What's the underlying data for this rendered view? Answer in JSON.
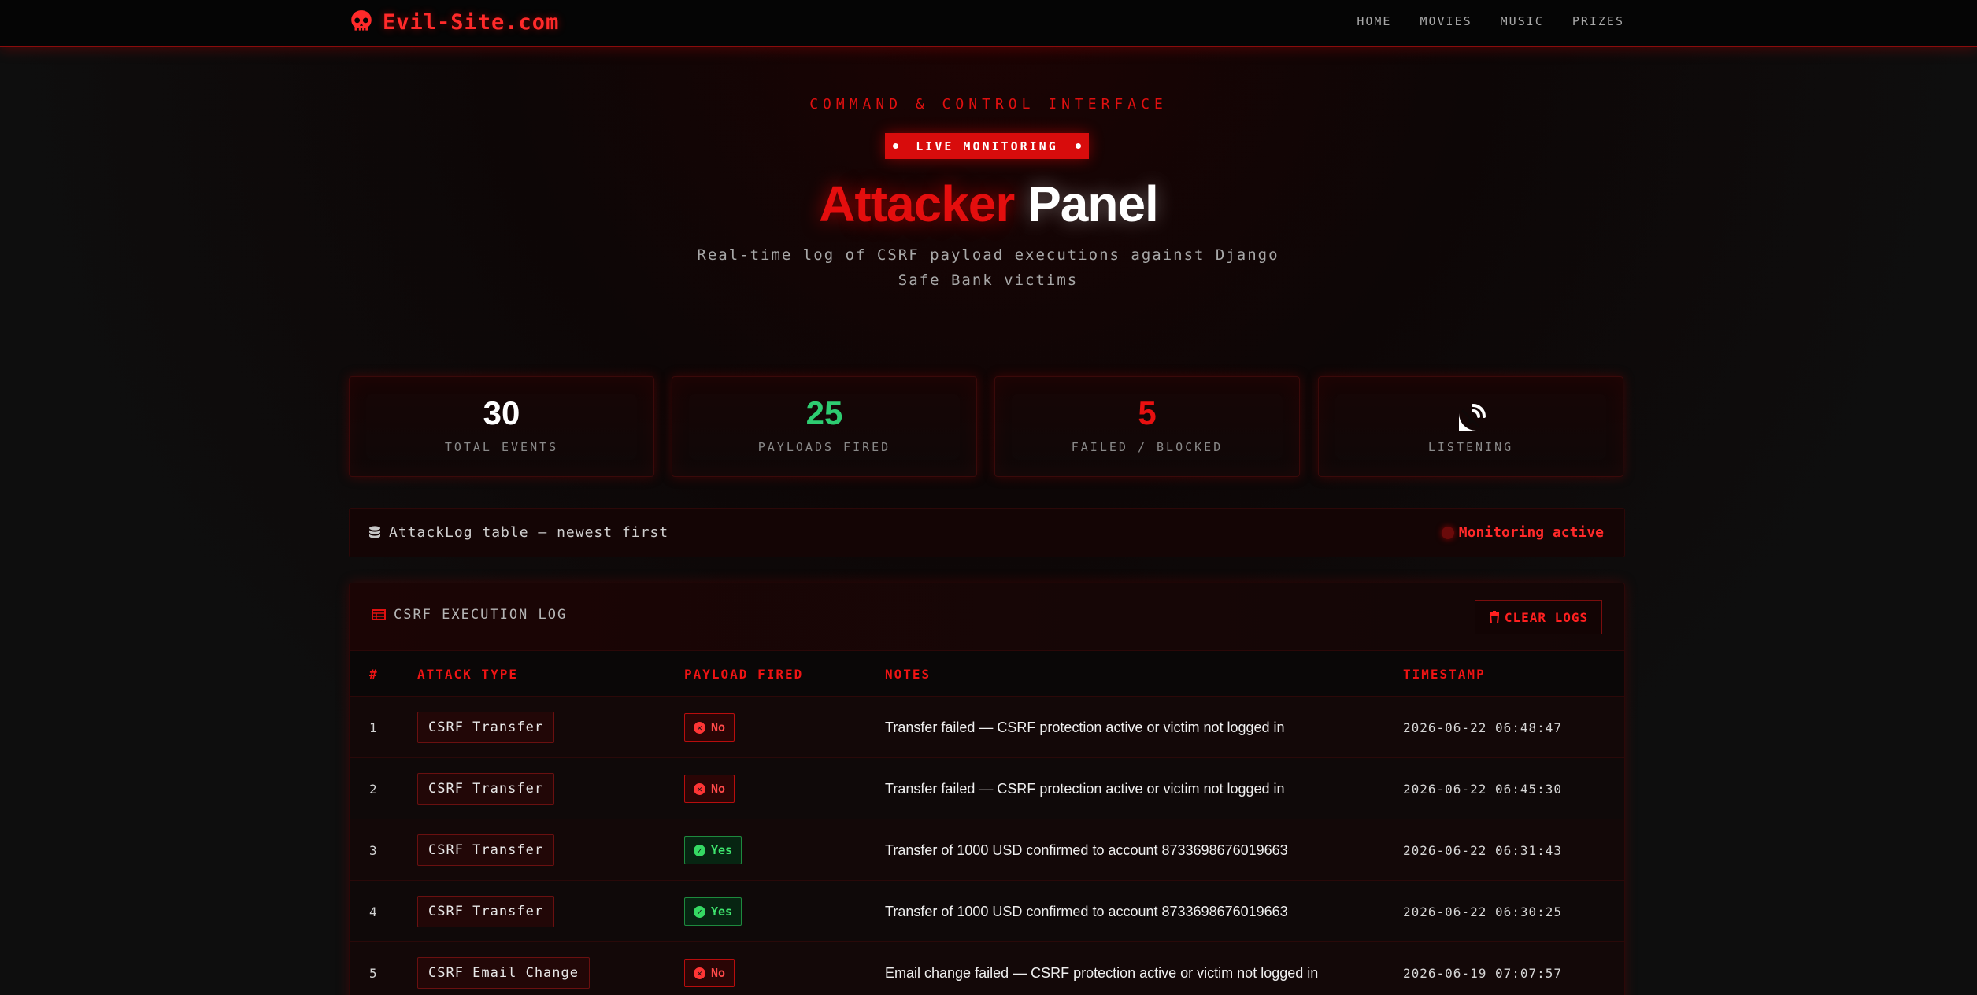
{
  "nav": {
    "brand": "Evil-Site.com",
    "links": [
      "HOME",
      "MOVIES",
      "MUSIC",
      "PRIZES"
    ]
  },
  "hero": {
    "kicker": "COMMAND & CONTROL INTERFACE",
    "badge": "LIVE MONITORING",
    "title_red": "Attacker",
    "title_white": "Panel",
    "subtitle": "Real-time log of CSRF payload executions against Django Safe Bank victims"
  },
  "stats": [
    {
      "value": "30",
      "label": "TOTAL EVENTS",
      "color": "#ffffff"
    },
    {
      "value": "25",
      "label": "PAYLOADS FIRED",
      "color": "#2ecc71"
    },
    {
      "value": "5",
      "label": "FAILED / BLOCKED",
      "color": "#e81010"
    },
    {
      "value": "",
      "label": "LISTENING",
      "color": "#ffffff",
      "icon": "satellite-dish-icon"
    }
  ],
  "status_bar": {
    "left": "AttackLog table — newest first",
    "right": "Monitoring active"
  },
  "log": {
    "title": "CSRF EXECUTION LOG",
    "clear_button": "CLEAR LOGS",
    "columns": [
      "#",
      "ATTACK TYPE",
      "PAYLOAD FIRED",
      "NOTES",
      "TIMESTAMP"
    ],
    "rows": [
      {
        "num": "1",
        "type": "CSRF Transfer",
        "fired": "No",
        "notes": "Transfer failed — CSRF protection active or victim not logged in",
        "time": "2026-06-22 06:48:47"
      },
      {
        "num": "2",
        "type": "CSRF Transfer",
        "fired": "No",
        "notes": "Transfer failed — CSRF protection active or victim not logged in",
        "time": "2026-06-22 06:45:30"
      },
      {
        "num": "3",
        "type": "CSRF Transfer",
        "fired": "Yes",
        "notes": "Transfer of 1000 USD confirmed to account 8733698676019663",
        "time": "2026-06-22 06:31:43"
      },
      {
        "num": "4",
        "type": "CSRF Transfer",
        "fired": "Yes",
        "notes": "Transfer of 1000 USD confirmed to account 8733698676019663",
        "time": "2026-06-22 06:30:25"
      },
      {
        "num": "5",
        "type": "CSRF Email Change",
        "fired": "No",
        "notes": "Email change failed — CSRF protection active or victim not logged in",
        "time": "2026-06-19 07:07:57"
      }
    ]
  }
}
